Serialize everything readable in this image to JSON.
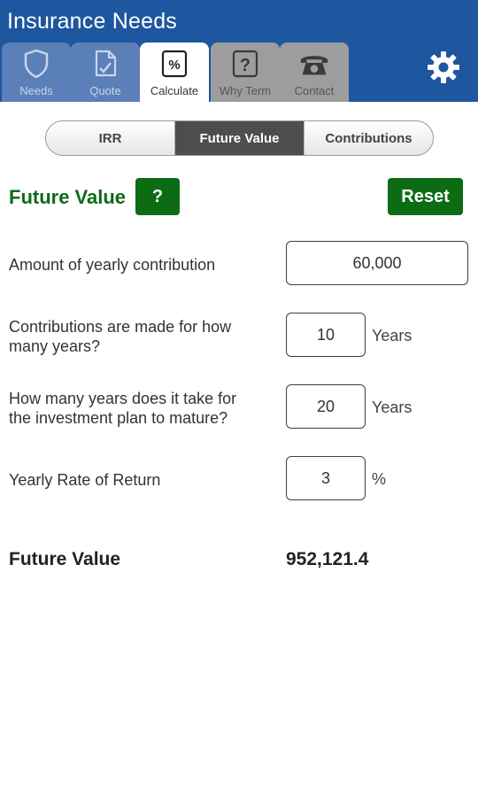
{
  "app": {
    "title": "Insurance Needs"
  },
  "tabs": [
    {
      "label": "Needs",
      "icon": "shield-icon"
    },
    {
      "label": "Quote",
      "icon": "quote-icon"
    },
    {
      "label": "Calculate",
      "icon": "percent-icon"
    },
    {
      "label": "Why Term",
      "icon": "question-icon"
    },
    {
      "label": "Contact",
      "icon": "phone-icon"
    }
  ],
  "active_tab": "Calculate",
  "settings": {
    "icon": "gear-icon"
  },
  "segments": [
    {
      "label": "IRR"
    },
    {
      "label": "Future Value"
    },
    {
      "label": "Contributions"
    }
  ],
  "active_segment": "Future Value",
  "section": {
    "title": "Future Value",
    "help_label": "?",
    "reset_label": "Reset"
  },
  "form": {
    "yearly_contribution": {
      "label": "Amount of yearly contribution",
      "value": "60,000"
    },
    "contribution_years": {
      "label_line1": "Contributions are made for how",
      "label_line2": "many years?",
      "value": "10",
      "unit": "Years"
    },
    "mature_years": {
      "label_line1": "How many years does it take for",
      "label_line2": "the investment plan to mature?",
      "value": "20",
      "unit": "Years"
    },
    "rate_of_return": {
      "label": "Yearly Rate of Return",
      "value": "3",
      "unit": "%"
    }
  },
  "result": {
    "label": "Future Value",
    "value": "952,121.4"
  },
  "colors": {
    "header": "#1e56a0",
    "tab_inactive_blue": "#5b7fb8",
    "tab_inactive_gray": "#9d9d9d",
    "accent_green": "#0c6c14",
    "segment_active": "#4d4d4d"
  }
}
